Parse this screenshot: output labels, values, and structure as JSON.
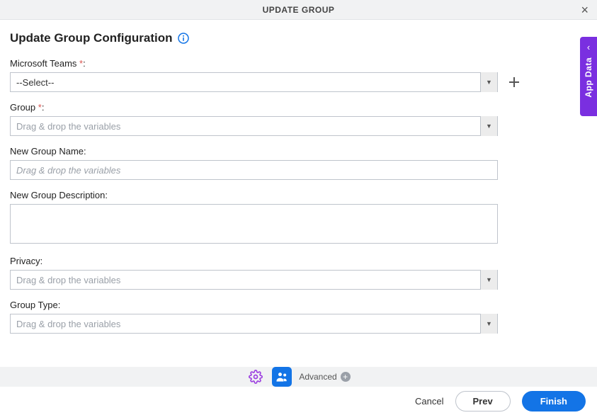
{
  "header": {
    "title": "UPDATE GROUP"
  },
  "page": {
    "title": "Update Group Configuration"
  },
  "fields": {
    "teams": {
      "label": "Microsoft Teams ",
      "required": "*",
      "colon": ":",
      "value": "--Select--",
      "placeholder": ""
    },
    "group": {
      "label": "Group ",
      "required": "*",
      "colon": ":",
      "placeholder": "Drag & drop the variables"
    },
    "newName": {
      "label": "New Group Name:",
      "placeholder": "Drag & drop the variables"
    },
    "newDesc": {
      "label": "New Group Description:",
      "value": ""
    },
    "privacy": {
      "label": "Privacy:",
      "placeholder": "Drag & drop the variables"
    },
    "groupType": {
      "label": "Group Type:",
      "placeholder": "Drag & drop the variables"
    }
  },
  "footer": {
    "advanced": "Advanced"
  },
  "buttons": {
    "cancel": "Cancel",
    "prev": "Prev",
    "finish": "Finish"
  },
  "sideTab": {
    "label": "App Data"
  }
}
